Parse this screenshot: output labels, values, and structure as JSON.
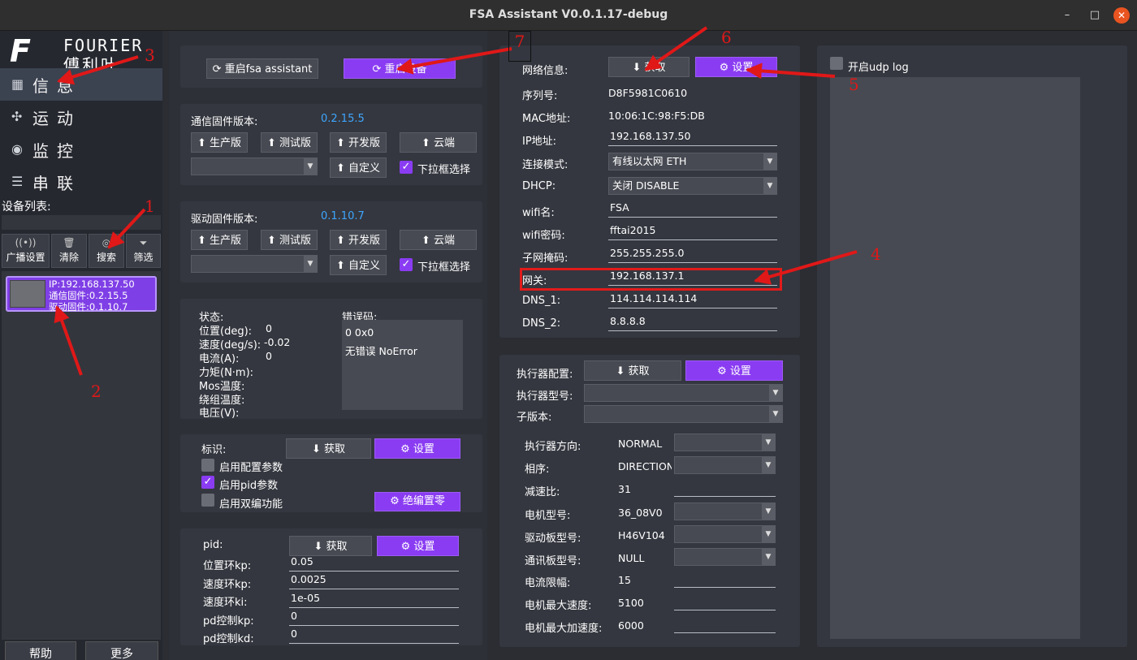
{
  "window": {
    "title": "FSA Assistant V0.0.1.17-debug",
    "min": "–",
    "max": "□",
    "close": "✕"
  },
  "logo": {
    "mark": "F",
    "en": "FOURIER",
    "cn": "傅利叶"
  },
  "nav": [
    {
      "label": "信息",
      "icon": "grid-icon"
    },
    {
      "label": "运动",
      "icon": "fan-icon"
    },
    {
      "label": "监控",
      "icon": "monitor-icon"
    },
    {
      "label": "串联",
      "icon": "sliders-icon"
    }
  ],
  "device_list": {
    "label": "设备列表:",
    "tools": [
      {
        "label": "广播设置",
        "icon": "((•))"
      },
      {
        "label": "清除",
        "icon": "🗑"
      },
      {
        "label": "搜索",
        "icon": "◎"
      },
      {
        "label": "筛选",
        "icon": "⏷"
      }
    ],
    "devices": [
      {
        "ip": "IP:192.168.137.50",
        "comm": "通信固件:0.2.15.5",
        "drive": "驱动固件:0.1.10.7"
      }
    ]
  },
  "bottom": {
    "help": "帮助",
    "more": "更多"
  },
  "restart": {
    "fsa": "重启fsa assistant",
    "device": "重启设备"
  },
  "comm_fw": {
    "label": "通信固件版本:",
    "version": "0.2.15.5",
    "b_prod": "生产版",
    "b_test": "测试版",
    "b_dev": "开发版",
    "b_cloud": "云端",
    "b_custom": "自定义",
    "dropdown_label": "下拉框选择"
  },
  "drive_fw": {
    "label": "驱动固件版本:",
    "version": "0.1.10.7",
    "b_prod": "生产版",
    "b_test": "测试版",
    "b_dev": "开发版",
    "b_cloud": "云端",
    "b_custom": "自定义",
    "dropdown_label": "下拉框选择"
  },
  "status": {
    "title": "状态:",
    "pos_label": "位置(deg):",
    "pos": "0",
    "vel_label": "速度(deg/s):",
    "vel": "-0.02",
    "cur_label": "电流(A):",
    "cur": "0",
    "torque_label": "力矩(N·m):",
    "mos_label": "Mos温度:",
    "winding_label": "绕组温度:",
    "volt_label": "电压(V):",
    "err_label": "错误码:",
    "err_code": "0 0x0",
    "err_text": "无错误 NoError"
  },
  "flags": {
    "label": "标识:",
    "get": "获取",
    "set": "设置",
    "cfg": "启用配置参数",
    "pid": "启用pid参数",
    "dual": "启用双编功能",
    "zero": "绝编置零",
    "cfg_on": false,
    "pid_on": true,
    "dual_on": false
  },
  "pid": {
    "label": "pid:",
    "get": "获取",
    "set": "设置",
    "pkp_l": "位置环kp:",
    "pkp": "0.05",
    "vkp_l": "速度环kp:",
    "vkp": "0.0025",
    "vki_l": "速度环ki:",
    "vki": "1e-05",
    "pdkp_l": "pd控制kp:",
    "pdkp": "0",
    "pdkd_l": "pd控制kd:",
    "pdkd": "0"
  },
  "network": {
    "label": "网络信息:",
    "get": "获取",
    "set": "设置",
    "sn_l": "序列号:",
    "sn": "D8F5981C0610",
    "mac_l": "MAC地址:",
    "mac": "10:06:1C:98:F5:DB",
    "ip_l": "IP地址:",
    "ip": "192.168.137.50",
    "mode_l": "连接模式:",
    "mode": "有线以太网 ETH",
    "dhcp_l": "DHCP:",
    "dhcp": "关闭 DISABLE",
    "wifi_l": "wifi名:",
    "wifi": "FSA",
    "wpw_l": "wifi密码:",
    "wpw": "fftai2015",
    "mask_l": "子网掩码:",
    "mask": "255.255.255.0",
    "gw_l": "网关:",
    "gw": "192.168.137.1",
    "dns1_l": "DNS_1:",
    "dns1": "114.114.114.114",
    "dns2_l": "DNS_2:",
    "dns2": "8.8.8.8"
  },
  "actuator": {
    "label": "执行器配置:",
    "get": "获取",
    "set": "设置",
    "type_l": "执行器型号:",
    "type": "",
    "sub_l": "子版本:",
    "sub": "",
    "dir_l": "执行器方向:",
    "dir": "NORMAL",
    "seq_l": "相序:",
    "seq": "DIRECTION",
    "ratio_l": "减速比:",
    "ratio": "31",
    "motor_l": "电机型号:",
    "motor": "36_08V0",
    "drv_l": "驱动板型号:",
    "drv": "H46V104",
    "comm_l": "通讯板型号:",
    "comm": "NULL",
    "cur_l": "电流限幅:",
    "cur": "15",
    "vmax_l": "电机最大速度:",
    "vmax": "5100",
    "amax_l": "电机最大加速度:",
    "amax": "6000"
  },
  "udp": {
    "label": "开启udp log",
    "on": false
  },
  "annotations": [
    "1",
    "2",
    "3",
    "4",
    "5",
    "6",
    "7"
  ],
  "colors": {
    "accent": "#8a3cf2",
    "highlight": "#e21b1b",
    "version_blue": "#3ea6ff"
  }
}
